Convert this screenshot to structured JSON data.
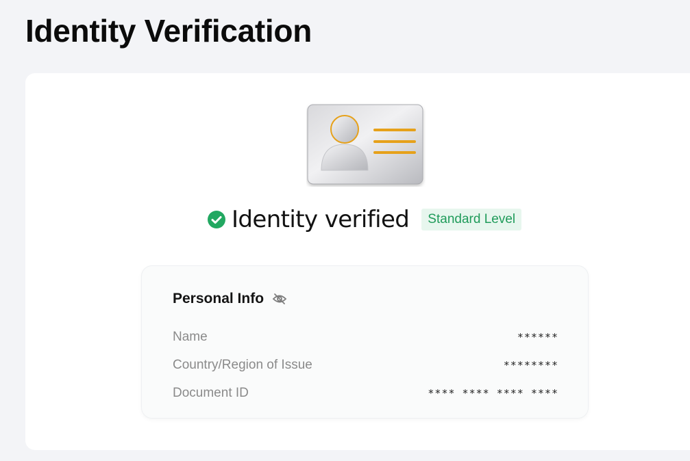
{
  "page": {
    "title": "Identity Verification"
  },
  "status": {
    "icon": "check-circle-icon",
    "text": "Identity verified",
    "badge": "Standard Level",
    "colors": {
      "success": "#22a861",
      "badge_bg": "#e7f6ee",
      "badge_text": "#1f9b5a"
    }
  },
  "illustration": {
    "icon": "id-card-icon",
    "accent_color": "#e6a11a"
  },
  "personal_info": {
    "title": "Personal Info",
    "visibility_icon": "eye-off-icon",
    "rows": [
      {
        "label": "Name",
        "value": "******"
      },
      {
        "label": "Country/Region of Issue",
        "value": "********"
      },
      {
        "label": "Document ID",
        "value": "**** **** **** ****"
      }
    ]
  }
}
